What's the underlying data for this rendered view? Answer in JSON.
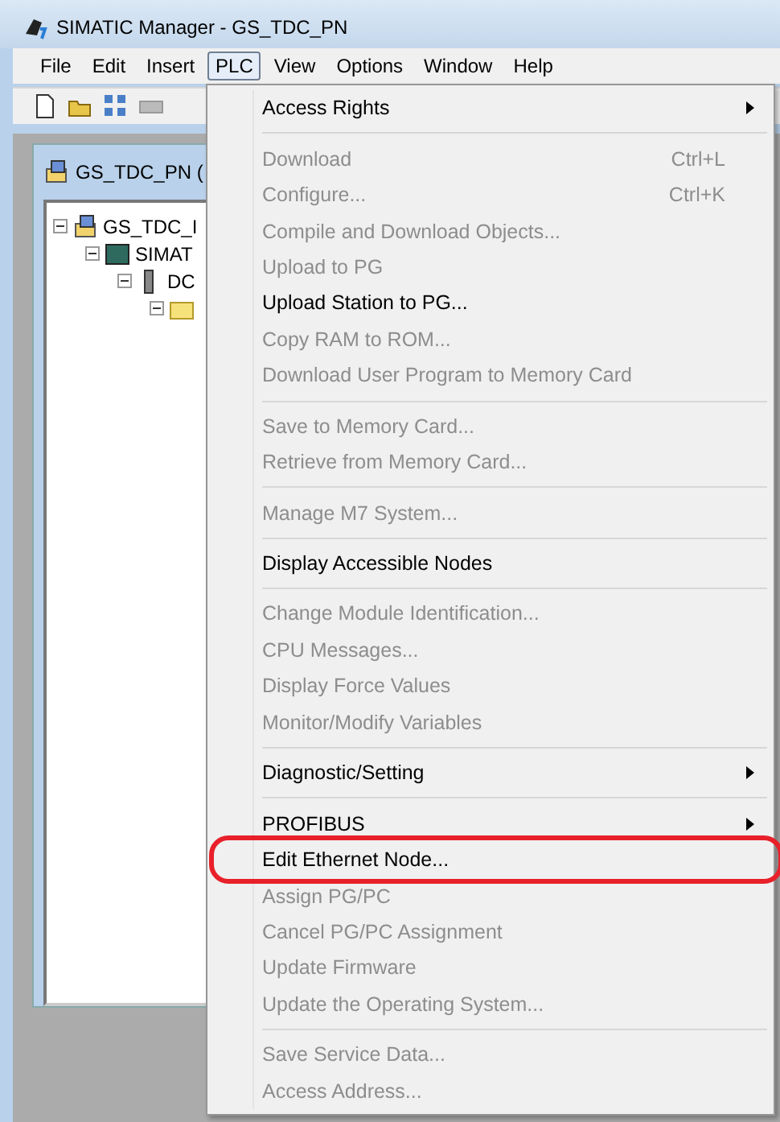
{
  "window": {
    "title": "SIMATIC Manager - GS_TDC_PN"
  },
  "menubar": [
    {
      "label": "File",
      "selected": false
    },
    {
      "label": "Edit",
      "selected": false
    },
    {
      "label": "Insert",
      "selected": false
    },
    {
      "label": "PLC",
      "selected": true
    },
    {
      "label": "View",
      "selected": false
    },
    {
      "label": "Options",
      "selected": false
    },
    {
      "label": "Window",
      "selected": false
    },
    {
      "label": "Help",
      "selected": false
    }
  ],
  "child_window": {
    "title": "GS_TDC_PN (",
    "tree": [
      {
        "label": "GS_TDC_I",
        "expanded": true,
        "children": [
          {
            "label": "SIMAT",
            "expanded": true,
            "children": [
              {
                "label": "DC",
                "expanded": true,
                "children": [
                  {
                    "expanded": true
                  }
                ]
              }
            ]
          }
        ]
      }
    ]
  },
  "menu": {
    "groups": [
      [
        {
          "label": "Access Rights",
          "disabled": false,
          "submenu": true
        }
      ],
      [
        {
          "label": "Download",
          "shortcut": "Ctrl+L",
          "disabled": true
        },
        {
          "label": "Configure...",
          "shortcut": "Ctrl+K",
          "disabled": true
        },
        {
          "label": "Compile and Download Objects...",
          "disabled": true
        },
        {
          "label": "Upload to PG",
          "disabled": true
        },
        {
          "label": "Upload Station to PG...",
          "disabled": false
        },
        {
          "label": "Copy RAM to ROM...",
          "disabled": true
        },
        {
          "label": "Download User Program to Memory Card",
          "disabled": true
        }
      ],
      [
        {
          "label": "Save to Memory Card...",
          "disabled": true
        },
        {
          "label": "Retrieve from Memory Card...",
          "disabled": true
        }
      ],
      [
        {
          "label": "Manage M7 System...",
          "disabled": true
        }
      ],
      [
        {
          "label": "Display Accessible Nodes",
          "disabled": false
        }
      ],
      [
        {
          "label": "Change Module Identification...",
          "disabled": true
        },
        {
          "label": "CPU Messages...",
          "disabled": true
        },
        {
          "label": "Display Force Values",
          "disabled": true
        },
        {
          "label": "Monitor/Modify Variables",
          "disabled": true
        }
      ],
      [
        {
          "label": "Diagnostic/Setting",
          "disabled": false,
          "submenu": true
        }
      ],
      [
        {
          "label": "PROFIBUS",
          "disabled": false,
          "submenu": true
        },
        {
          "label": "Edit Ethernet Node...",
          "disabled": false,
          "highlighted": true
        },
        {
          "label": "Assign PG/PC",
          "disabled": true
        },
        {
          "label": "Cancel PG/PC Assignment",
          "disabled": true
        },
        {
          "label": "Update Firmware",
          "disabled": true
        },
        {
          "label": "Update the Operating System...",
          "disabled": true
        }
      ],
      [
        {
          "label": "Save Service Data...",
          "disabled": true
        },
        {
          "label": "Access Address...",
          "disabled": true
        }
      ]
    ]
  }
}
